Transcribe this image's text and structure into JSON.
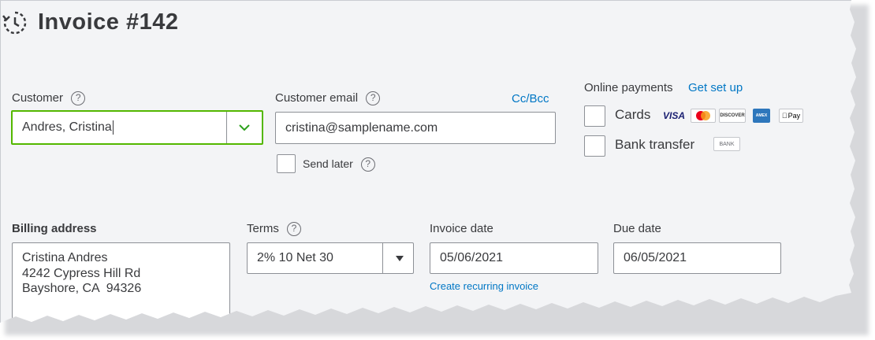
{
  "header": {
    "title": "Invoice #142",
    "icon": "clock-history-icon"
  },
  "customer": {
    "label": "Customer",
    "value": "Andres, Cristina"
  },
  "customer_email": {
    "label": "Customer email",
    "value": "cristina@samplename.com",
    "cc_bcc": "Cc/Bcc"
  },
  "send_later": {
    "label": "Send later",
    "checked": false
  },
  "online_payments": {
    "label": "Online payments",
    "setup_link": "Get set up",
    "options": [
      {
        "label": "Cards",
        "checked": false
      },
      {
        "label": "Bank transfer",
        "checked": false
      }
    ],
    "card_logos": [
      "VISA",
      "MC",
      "DISCOVER",
      "AMEX",
      "Pay"
    ],
    "bank_logo": "BANK"
  },
  "billing_address": {
    "label": "Billing address",
    "lines": [
      "Cristina Andres",
      "4242 Cypress Hill Rd",
      "Bayshore, CA  94326"
    ]
  },
  "terms": {
    "label": "Terms",
    "value": "2% 10 Net 30"
  },
  "invoice_date": {
    "label": "Invoice date",
    "value": "05/06/2021",
    "recurring_link": "Create recurring invoice"
  },
  "due_date": {
    "label": "Due date",
    "value": "06/05/2021"
  },
  "colors": {
    "accent_green": "#53b700",
    "link_blue": "#0077c5",
    "text": "#393a3d"
  }
}
